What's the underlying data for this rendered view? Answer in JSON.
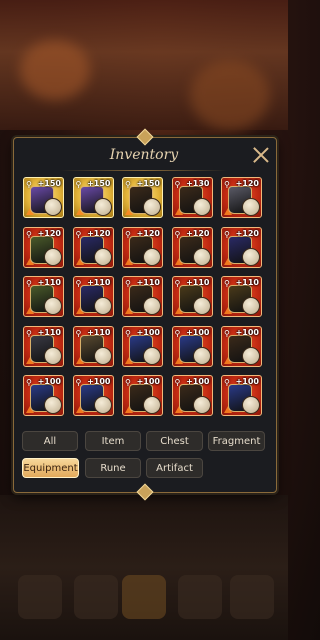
{
  "window": {
    "title": "Inventory"
  },
  "filters": {
    "row1": [
      "All",
      "Item",
      "Chest",
      "Fragment"
    ],
    "row2": [
      "Equipment",
      "Rune",
      "Artifact"
    ],
    "active": "Equipment"
  },
  "items": [
    {
      "level": "+150",
      "tier": "gold",
      "color": "#6a4aa8",
      "icon": "staff-icon"
    },
    {
      "level": "+150",
      "tier": "gold",
      "color": "#6a4aa8",
      "icon": "armor-icon"
    },
    {
      "level": "+150",
      "tier": "gold",
      "color": "#3b2a1a",
      "icon": "armor-icon"
    },
    {
      "level": "+130",
      "tier": "red",
      "color": "#3b2a1a",
      "icon": "helmet-icon"
    },
    {
      "level": "+120",
      "tier": "red",
      "color": "#5a5a66",
      "icon": "sword-icon"
    },
    {
      "level": "+120",
      "tier": "red",
      "color": "#4a5a2a",
      "icon": "armor-icon"
    },
    {
      "level": "+120",
      "tier": "red",
      "color": "#2a2a66",
      "icon": "armor-icon"
    },
    {
      "level": "+120",
      "tier": "red",
      "color": "#3b2a1a",
      "icon": "armor-icon"
    },
    {
      "level": "+120",
      "tier": "red",
      "color": "#3b2a1a",
      "icon": "shoulder-icon"
    },
    {
      "level": "+120",
      "tier": "red",
      "color": "#2a2a66",
      "icon": "armor-icon"
    },
    {
      "level": "+110",
      "tier": "red",
      "color": "#4a5a2a",
      "icon": "armor-icon"
    },
    {
      "level": "+110",
      "tier": "red",
      "color": "#2a2a66",
      "icon": "armor-icon"
    },
    {
      "level": "+110",
      "tier": "red",
      "color": "#3b2a1a",
      "icon": "armor-icon"
    },
    {
      "level": "+110",
      "tier": "red",
      "color": "#4a3a1a",
      "icon": "armor-icon"
    },
    {
      "level": "+110",
      "tier": "red",
      "color": "#4a3a1a",
      "icon": "armor-icon"
    },
    {
      "level": "+110",
      "tier": "red",
      "color": "#3a3a44",
      "icon": "armor-icon"
    },
    {
      "level": "+110",
      "tier": "red",
      "color": "#5a4a30",
      "icon": "armor-icon"
    },
    {
      "level": "+100",
      "tier": "red",
      "color": "#2a3a88",
      "icon": "armor-icon"
    },
    {
      "level": "+100",
      "tier": "red",
      "color": "#2a3a88",
      "icon": "armor-icon"
    },
    {
      "level": "+100",
      "tier": "red",
      "color": "#3b2a1a",
      "icon": "shield-icon"
    },
    {
      "level": "+100",
      "tier": "red",
      "color": "#2a3a88",
      "icon": "armor-icon"
    },
    {
      "level": "+100",
      "tier": "red",
      "color": "#2a3a88",
      "icon": "armor-icon"
    },
    {
      "level": "+100",
      "tier": "red",
      "color": "#3b2a1a",
      "icon": "shield-icon"
    },
    {
      "level": "+100",
      "tier": "red",
      "color": "#3b2a1a",
      "icon": "shield-icon"
    },
    {
      "level": "+100",
      "tier": "red",
      "color": "#2a3a88",
      "icon": "armor-icon"
    }
  ]
}
